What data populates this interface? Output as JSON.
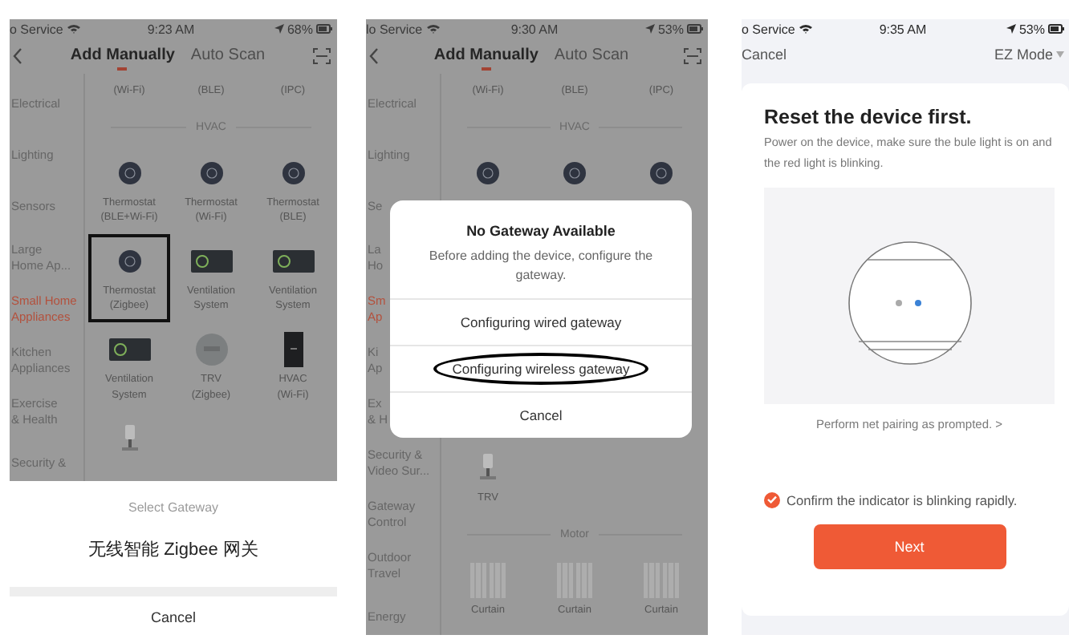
{
  "phones": [
    {
      "kind": "catalog",
      "status": {
        "carrier": "o Service",
        "time": "9:23 AM",
        "battery": "68%"
      },
      "tabs": [
        {
          "label": "Add Manually",
          "selected": true
        },
        {
          "label": "Auto Scan",
          "selected": false
        }
      ],
      "sidebar": [
        {
          "lines": [
            "Electrical"
          ],
          "selected": false
        },
        {
          "lines": [
            "Lighting"
          ],
          "selected": false
        },
        {
          "lines": [
            "Sensors"
          ],
          "selected": false
        },
        {
          "lines": [
            "Large",
            "Home Ap..."
          ],
          "selected": false
        },
        {
          "lines": [
            "Small Home",
            "Appliances"
          ],
          "selected": true
        },
        {
          "lines": [
            "Kitchen",
            "Appliances"
          ],
          "selected": false
        },
        {
          "lines": [
            "Exercise",
            "& Health"
          ],
          "selected": false
        },
        {
          "lines": [
            "Security &"
          ],
          "selected": false
        }
      ],
      "sections": [
        {
          "kind": "items",
          "items": [
            {
              "kind": "text",
              "lines": [
                "(Wi-Fi)"
              ],
              "boxed": false
            },
            {
              "kind": "text",
              "lines": [
                "(BLE)"
              ],
              "boxed": false
            },
            {
              "kind": "text",
              "lines": [
                "(IPC)"
              ],
              "boxed": false
            }
          ]
        },
        {
          "kind": "divider",
          "label": "HVAC"
        },
        {
          "kind": "items",
          "items": [
            {
              "kind": "thermostat",
              "lines": [
                "Thermostat",
                "(BLE+Wi-Fi)"
              ],
              "boxed": false
            },
            {
              "kind": "thermostat",
              "lines": [
                "Thermostat",
                "(Wi-Fi)"
              ],
              "boxed": false
            },
            {
              "kind": "thermostat",
              "lines": [
                "Thermostat",
                "(BLE)"
              ],
              "boxed": false
            }
          ]
        },
        {
          "kind": "items",
          "items": [
            {
              "kind": "thermostat",
              "lines": [
                "Thermostat",
                "(Zigbee)"
              ],
              "boxed": true
            },
            {
              "kind": "ventilation",
              "lines": [
                "Ventilation",
                "System"
              ],
              "boxed": false
            },
            {
              "kind": "ventilation",
              "lines": [
                "Ventilation",
                "System"
              ],
              "boxed": false
            }
          ]
        },
        {
          "kind": "items",
          "items": [
            {
              "kind": "ventilation",
              "lines": [
                "Ventilation",
                "System"
              ],
              "boxed": false
            },
            {
              "kind": "trv",
              "lines": [
                "TRV",
                "(Zigbee)"
              ],
              "boxed": false
            },
            {
              "kind": "hvac",
              "lines": [
                "HVAC",
                "(Wi-Fi)"
              ],
              "boxed": false
            }
          ]
        },
        {
          "kind": "items",
          "items": [
            {
              "kind": "valve",
              "boxed": false
            }
          ]
        }
      ],
      "sheet": {
        "title": "Select Gateway",
        "options": [
          "无线智能 Zigbee 网关"
        ],
        "cancel": "Cancel"
      }
    },
    {
      "kind": "catalog",
      "status": {
        "carrier": "lo Service",
        "time": "9:30 AM",
        "battery": "53%"
      },
      "tabs": [
        {
          "label": "Add Manually",
          "selected": true
        },
        {
          "label": "Auto Scan",
          "selected": false
        }
      ],
      "sidebar": [
        {
          "lines": [
            "Electrical"
          ],
          "selected": false
        },
        {
          "lines": [
            "Lighting"
          ],
          "selected": false
        },
        {
          "lines": [
            "Se"
          ],
          "selected": false
        },
        {
          "lines": [
            "La",
            "Ho"
          ],
          "selected": false
        },
        {
          "lines": [
            "Sm",
            "Ap"
          ],
          "selected": true
        },
        {
          "lines": [
            "Ki",
            "Ap"
          ],
          "selected": false
        },
        {
          "lines": [
            "Ex",
            "& H"
          ],
          "selected": false
        },
        {
          "lines": [
            "Security &",
            "Video Sur..."
          ],
          "selected": false
        },
        {
          "lines": [
            "Gateway",
            "Control"
          ],
          "selected": false
        },
        {
          "lines": [
            "Outdoor",
            "Travel"
          ],
          "selected": false
        },
        {
          "lines": [
            "Energy"
          ],
          "selected": false
        }
      ],
      "sections": [
        {
          "kind": "items",
          "items": [
            {
              "kind": "text",
              "lines": [
                "(Wi-Fi)"
              ],
              "boxed": false
            },
            {
              "kind": "text",
              "lines": [
                "(BLE)"
              ],
              "boxed": false
            },
            {
              "kind": "text",
              "lines": [
                "(IPC)"
              ],
              "boxed": false
            }
          ]
        },
        {
          "kind": "divider",
          "label": "HVAC"
        },
        {
          "kind": "items",
          "items": [
            {
              "kind": "thermostat",
              "boxed": false
            },
            {
              "kind": "thermostat",
              "boxed": false
            },
            {
              "kind": "thermostat",
              "boxed": false
            }
          ]
        },
        {
          "kind": "hidden"
        },
        {
          "kind": "items",
          "items": [
            {
              "kind": "valve",
              "lines": [
                "TRV"
              ],
              "boxed": false
            }
          ]
        },
        {
          "kind": "divider",
          "label": "Motor"
        },
        {
          "kind": "items",
          "items": [
            {
              "kind": "curtain",
              "lines": [
                "Curtain"
              ],
              "boxed": false
            },
            {
              "kind": "curtain",
              "lines": [
                "Curtain"
              ],
              "boxed": false
            },
            {
              "kind": "curtain",
              "lines": [
                "Curtain"
              ],
              "boxed": false
            }
          ]
        }
      ],
      "dialog": {
        "title": "No Gateway Available",
        "message": "Before adding the device, configure the gateway.",
        "options": [
          {
            "label": "Configuring wired gateway",
            "circled": false
          },
          {
            "label": "Configuring wireless gateway",
            "circled": true
          }
        ],
        "cancel": "Cancel"
      }
    },
    {
      "kind": "setup",
      "status": {
        "carrier": "o Service",
        "time": "9:35 AM",
        "battery": "53%"
      },
      "nav": {
        "cancel": "Cancel",
        "mode": "EZ Mode"
      },
      "title": "Reset the device first.",
      "message": "Power on the device, make sure the bule light is on and the red light is blinking.",
      "link": "Perform net pairing as prompted. >",
      "confirm": {
        "label": "Confirm the indicator is blinking rapidly.",
        "checked": true
      },
      "button": "Next"
    }
  ]
}
